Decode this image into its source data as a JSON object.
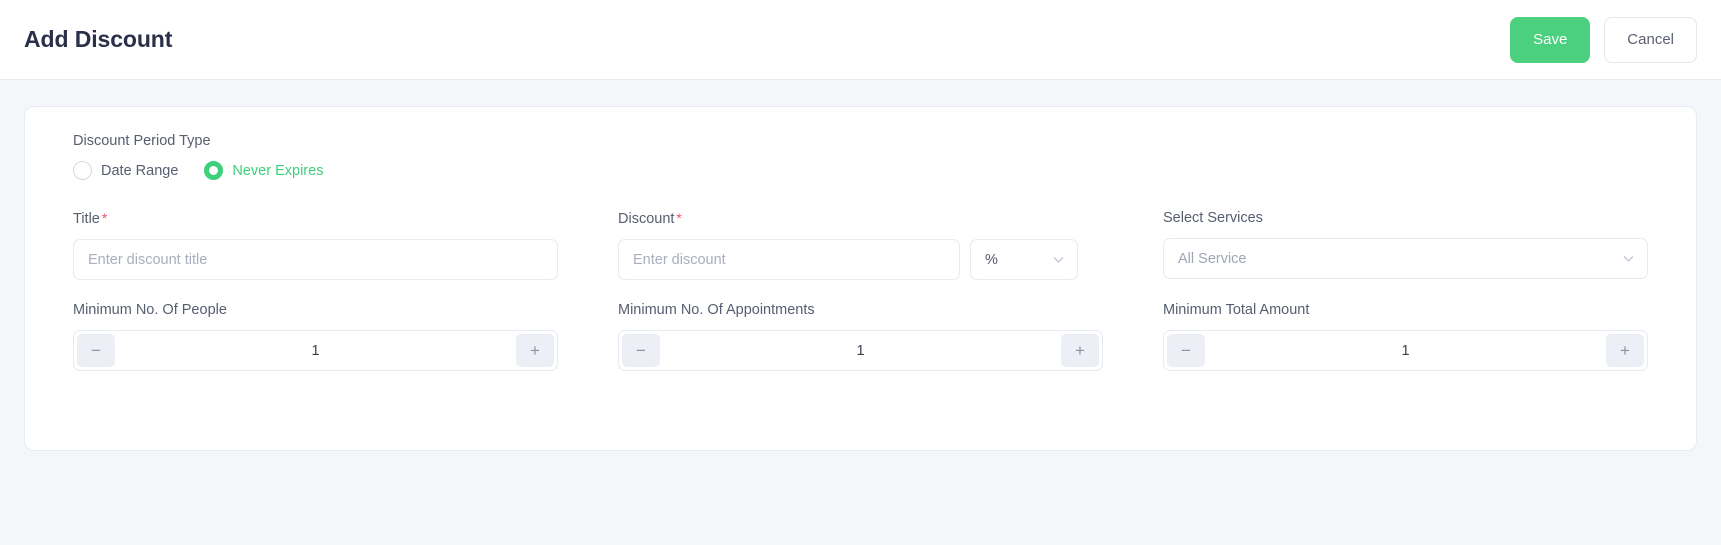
{
  "header": {
    "title": "Add Discount",
    "save_label": "Save",
    "cancel_label": "Cancel",
    "save_color": "#4ad07f"
  },
  "form": {
    "period_type": {
      "label": "Discount Period Type",
      "options": [
        {
          "label": "Date Range",
          "selected": false
        },
        {
          "label": "Never Expires",
          "selected": true
        }
      ],
      "selected_color": "#3fd07c"
    },
    "title_field": {
      "label": "Title",
      "required_marker": "*",
      "placeholder": "Enter discount title",
      "value": ""
    },
    "discount_field": {
      "label": "Discount",
      "required_marker": "*",
      "placeholder": "Enter discount",
      "value": "",
      "unit_value": "%"
    },
    "services_field": {
      "label": "Select Services",
      "value": "All Service"
    },
    "min_people": {
      "label": "Minimum No. Of People",
      "value": "1",
      "decrement": "−",
      "increment": "+"
    },
    "min_appointments": {
      "label": "Minimum No. Of Appointments",
      "value": "1",
      "decrement": "−",
      "increment": "+"
    },
    "min_total_amount": {
      "label": "Minimum Total Amount",
      "value": "1",
      "decrement": "−",
      "increment": "+"
    }
  }
}
